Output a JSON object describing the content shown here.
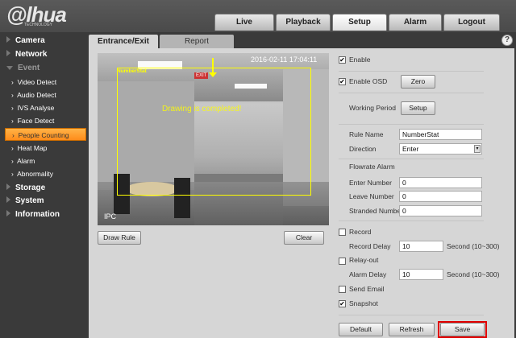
{
  "brand": {
    "logo": "alhua",
    "tagline": "TECHNOLOGY"
  },
  "top_tabs": [
    {
      "label": "Live"
    },
    {
      "label": "Playback"
    },
    {
      "label": "Setup",
      "active": true
    },
    {
      "label": "Alarm"
    },
    {
      "label": "Logout"
    }
  ],
  "sidebar": {
    "sections": [
      {
        "label": "Camera"
      },
      {
        "label": "Network"
      },
      {
        "label": "Event"
      }
    ],
    "event_items": [
      {
        "label": "Video Detect"
      },
      {
        "label": "Audio Detect"
      },
      {
        "label": "IVS Analyse"
      },
      {
        "label": "Face Detect"
      },
      {
        "label": "People Counting",
        "active": true
      },
      {
        "label": "Heat Map"
      },
      {
        "label": "Alarm"
      },
      {
        "label": "Abnormality"
      }
    ],
    "bottom_sections": [
      {
        "label": "Storage"
      },
      {
        "label": "System"
      },
      {
        "label": "Information"
      }
    ]
  },
  "sub_tabs": [
    {
      "label": "Entrance/Exit",
      "active": true
    },
    {
      "label": "Report"
    }
  ],
  "help_icon": "question-circle-icon",
  "video": {
    "timestamp": "2016-02-11 17:04:11",
    "rule_label": "NumberStat",
    "message": "Drawing is completed!",
    "channel": "IPC",
    "rule_color": "#ffff00"
  },
  "video_buttons": {
    "draw_rule": "Draw Rule",
    "clear": "Clear"
  },
  "form": {
    "enable": {
      "label": "Enable",
      "checked": true
    },
    "enable_osd": {
      "label": "Enable OSD",
      "checked": true,
      "button": "Zero"
    },
    "working_period": {
      "label": "Working Period",
      "button": "Setup"
    },
    "rule_name": {
      "label": "Rule Name",
      "value": "NumberStat"
    },
    "direction": {
      "label": "Direction",
      "value": "Enter"
    },
    "flowrate_alarm": "Flowrate Alarm",
    "enter_number": {
      "label": "Enter Number",
      "value": "0"
    },
    "leave_number": {
      "label": "Leave Number",
      "value": "0"
    },
    "stranded_number": {
      "label": "Stranded Number",
      "value": "0"
    },
    "record": {
      "label": "Record",
      "checked": false
    },
    "record_delay": {
      "label": "Record Delay",
      "value": "10",
      "unit": "Second (10~300)"
    },
    "relay_out": {
      "label": "Relay-out",
      "checked": false
    },
    "alarm_delay": {
      "label": "Alarm Delay",
      "value": "10",
      "unit": "Second (10~300)"
    },
    "send_email": {
      "label": "Send Email",
      "checked": false
    },
    "snapshot": {
      "label": "Snapshot",
      "checked": true
    }
  },
  "footer": {
    "default": "Default",
    "refresh": "Refresh",
    "save": "Save",
    "save_highlight": "#e00000"
  },
  "check": "✔"
}
